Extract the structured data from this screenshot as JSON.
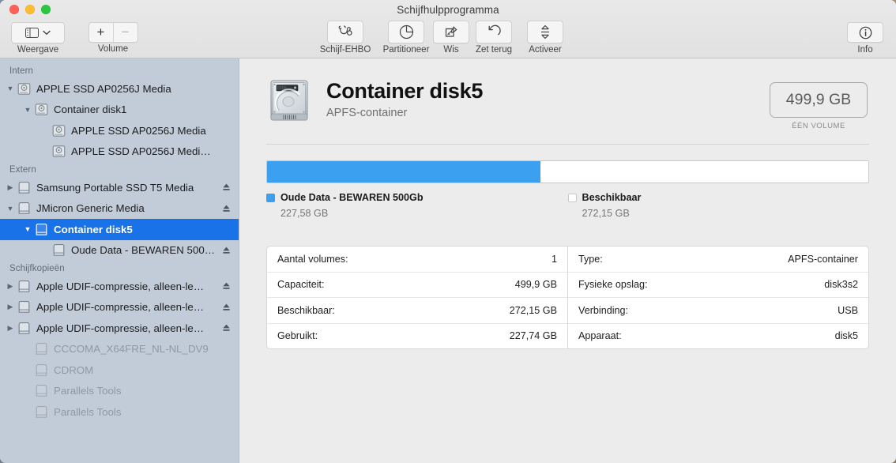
{
  "window": {
    "title": "Schijfhulpprogramma",
    "traffic_lights": [
      "close",
      "minimize",
      "maximize"
    ]
  },
  "toolbar": {
    "view": {
      "label": "Weergave",
      "icon": "sidebar-icon",
      "chevron": "chevron-down-icon"
    },
    "volume": {
      "label": "Volume",
      "add": "+",
      "remove": "−"
    },
    "actions": [
      {
        "label": "Schijf-EHBO",
        "icon": "stethoscope-icon"
      },
      {
        "label": "Partitioneer",
        "icon": "pie-chart-icon"
      },
      {
        "label": "Wis",
        "icon": "erase-icon"
      },
      {
        "label": "Zet terug",
        "icon": "restore-icon"
      },
      {
        "label": "Activeer",
        "icon": "mount-icon"
      }
    ],
    "info": {
      "label": "Info",
      "icon": "info-circle-icon"
    }
  },
  "sidebar": {
    "groups": [
      {
        "header": "Intern",
        "items": [
          {
            "label": "APPLE SSD AP0256J Media",
            "indent": 0,
            "triangle": "down",
            "icon": "internal-disk-icon",
            "eject": false,
            "selected": false,
            "dimmed": false
          },
          {
            "label": "Container disk1",
            "indent": 1,
            "triangle": "down",
            "icon": "internal-disk-icon",
            "eject": false,
            "selected": false,
            "dimmed": false
          },
          {
            "label": "APPLE SSD AP0256J Media",
            "indent": 2,
            "triangle": "none",
            "icon": "internal-disk-icon",
            "eject": false,
            "selected": false,
            "dimmed": false
          },
          {
            "label": "APPLE SSD AP0256J Media -…",
            "indent": 2,
            "triangle": "none",
            "icon": "internal-disk-icon",
            "eject": false,
            "selected": false,
            "dimmed": false
          }
        ]
      },
      {
        "header": "Extern",
        "items": [
          {
            "label": "Samsung Portable SSD T5 Media",
            "indent": 0,
            "triangle": "right",
            "icon": "external-disk-icon",
            "eject": true,
            "selected": false,
            "dimmed": false
          },
          {
            "label": "JMicron Generic Media",
            "indent": 0,
            "triangle": "down",
            "icon": "external-disk-icon",
            "eject": true,
            "selected": false,
            "dimmed": false
          },
          {
            "label": "Container disk5",
            "indent": 1,
            "triangle": "down",
            "icon": "external-disk-icon",
            "eject": false,
            "selected": true,
            "dimmed": false
          },
          {
            "label": "Oude Data - BEWAREN 500…",
            "indent": 2,
            "triangle": "none",
            "icon": "external-disk-icon",
            "eject": true,
            "selected": false,
            "dimmed": false
          }
        ]
      },
      {
        "header": "Schijfkopieën",
        "items": [
          {
            "label": "Apple UDIF-compressie, alleen-le…",
            "indent": 0,
            "triangle": "right",
            "icon": "external-disk-icon",
            "eject": true,
            "selected": false,
            "dimmed": false
          },
          {
            "label": "Apple UDIF-compressie, alleen-le…",
            "indent": 0,
            "triangle": "right",
            "icon": "external-disk-icon",
            "eject": true,
            "selected": false,
            "dimmed": false
          },
          {
            "label": "Apple UDIF-compressie, alleen-le…",
            "indent": 0,
            "triangle": "right",
            "icon": "external-disk-icon",
            "eject": true,
            "selected": false,
            "dimmed": false
          },
          {
            "label": "CCCOMA_X64FRE_NL-NL_DV9",
            "indent": 1,
            "triangle": "none",
            "icon": "external-disk-icon",
            "eject": false,
            "selected": false,
            "dimmed": true
          },
          {
            "label": "CDROM",
            "indent": 1,
            "triangle": "none",
            "icon": "external-disk-icon",
            "eject": false,
            "selected": false,
            "dimmed": true
          },
          {
            "label": "Parallels Tools",
            "indent": 1,
            "triangle": "none",
            "icon": "external-disk-icon",
            "eject": false,
            "selected": false,
            "dimmed": true
          },
          {
            "label": "Parallels Tools",
            "indent": 1,
            "triangle": "none",
            "icon": "external-disk-icon",
            "eject": false,
            "selected": false,
            "dimmed": true
          }
        ]
      }
    ]
  },
  "main": {
    "disk_icon": "hard-drive-icon",
    "title": "Container disk5",
    "subtitle": "APFS-container",
    "capacity_badge": {
      "value": "499,9 GB",
      "caption": "ÉÉN VOLUME"
    },
    "usage_bar": {
      "used_percent": 45.5,
      "free_percent": 54.5,
      "used_color": "#3aa0ef",
      "free_color": "#ffffff"
    },
    "legend": [
      {
        "name": "Oude Data - BEWAREN 500Gb",
        "value": "227,58 GB",
        "color": "#3aa0ef"
      },
      {
        "name": "Beschikbaar",
        "value": "272,15 GB",
        "color": "#ffffff"
      }
    ],
    "details_left": [
      {
        "label": "Aantal volumes:",
        "value": "1"
      },
      {
        "label": "Capaciteit:",
        "value": "499,9 GB"
      },
      {
        "label": "Beschikbaar:",
        "value": "272,15 GB"
      },
      {
        "label": "Gebruikt:",
        "value": "227,74 GB"
      }
    ],
    "details_right": [
      {
        "label": "Type:",
        "value": "APFS-container"
      },
      {
        "label": "Fysieke opslag:",
        "value": "disk3s2"
      },
      {
        "label": "Verbinding:",
        "value": "USB"
      },
      {
        "label": "Apparaat:",
        "value": "disk5"
      }
    ]
  }
}
